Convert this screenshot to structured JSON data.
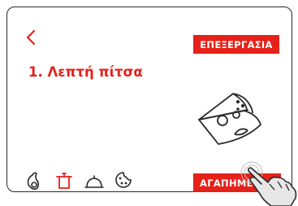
{
  "header": {
    "back_icon": "chevron-left-icon",
    "edit_label": "ΕΠΕΞΕΡΓΑΣΙΑ"
  },
  "recipe": {
    "title": "1. Λεπτή πίτσα",
    "illustration_icon": "pizza-slice-icon"
  },
  "toolbar": {
    "icons": [
      "ingredients-icon",
      "pot-icon",
      "serving-cloche-icon",
      "cookie-icon"
    ],
    "favorite_label": "ΑΓΑΠΗΜΕΝΑ"
  },
  "colors": {
    "accent": "#e52119",
    "text": "#2a2a2a",
    "background": "#ffffff"
  }
}
